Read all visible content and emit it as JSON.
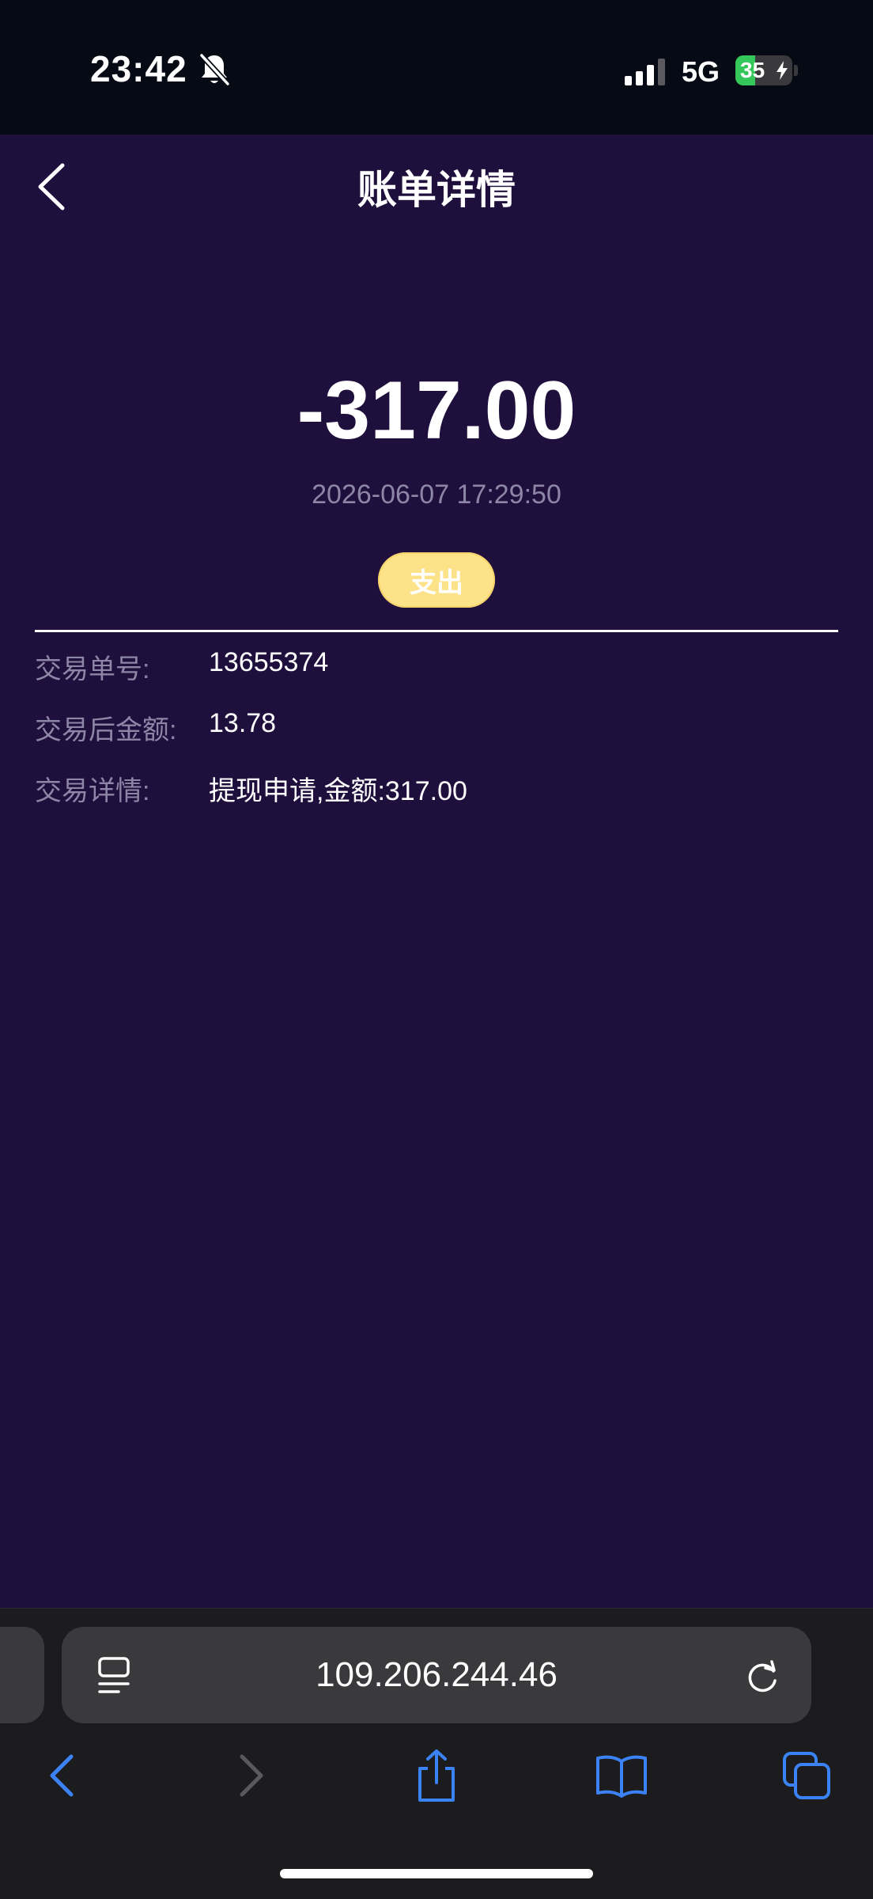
{
  "status_bar": {
    "time": "23:42",
    "network": "5G",
    "battery_level": "35",
    "battery_fraction": 0.35,
    "icons": [
      "bell-slash-icon",
      "signal-icon",
      "battery-icon",
      "bolt-icon"
    ]
  },
  "header": {
    "title": "账单详情",
    "back_icon": "chevron-left-icon"
  },
  "transaction": {
    "amount": "-317.00",
    "datetime": "2026-06-07 17:29:50",
    "type_badge": "支出",
    "details": [
      {
        "label": "交易单号:",
        "value": "13655374"
      },
      {
        "label": "交易后金额:",
        "value": "13.78"
      },
      {
        "label": "交易详情:",
        "value": "提现申请,金额:317.00"
      }
    ]
  },
  "browser": {
    "url": "109.206.244.46",
    "icons": [
      "reader-icon",
      "reload-icon",
      "back-icon",
      "forward-icon",
      "share-icon",
      "bookmarks-icon",
      "tabs-icon"
    ]
  },
  "colors": {
    "background": "#1f0f3c",
    "badge": "#fce38a",
    "muted_text": "#8e86a6",
    "browser_accent": "#3b82f6"
  }
}
